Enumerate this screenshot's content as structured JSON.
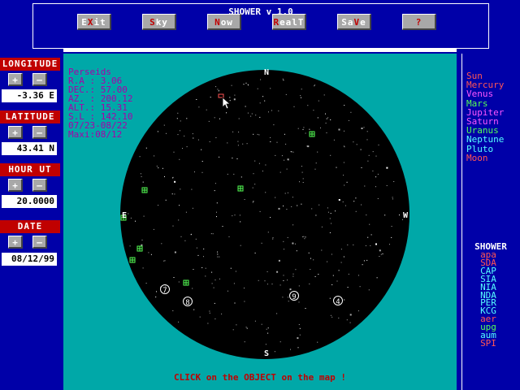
{
  "app": {
    "title": "SHOWER v 1.0"
  },
  "toolbar": {
    "buttons": [
      {
        "pre": "E",
        "hk": "X",
        "post": "it"
      },
      {
        "pre": "",
        "hk": "S",
        "post": "ky"
      },
      {
        "pre": "",
        "hk": "N",
        "post": "ow"
      },
      {
        "pre": "",
        "hk": "R",
        "post": "ealT"
      },
      {
        "pre": "Sa",
        "hk": "V",
        "post": "e"
      },
      {
        "pre": "",
        "hk": "",
        "post": "?"
      }
    ]
  },
  "controls": {
    "plus": "+",
    "minus": "–",
    "longitude": {
      "label": "LONGITUDE",
      "value": "-3.36  E"
    },
    "latitude": {
      "label": "LATITUDE",
      "value": "43.41  N"
    },
    "hour": {
      "label": "HOUR  UT",
      "value": "20.0000"
    },
    "date": {
      "label": "DATE",
      "value": "08/12/99"
    }
  },
  "info": {
    "name": "Perseids",
    "ra": "R.A : 3.06",
    "dec": "DEC.: 57.00",
    "az": "AZ. : 200.12",
    "alt": "ALT.: 15.31",
    "sl": "S.L : 142.10",
    "period": "07/23-08/22",
    "maxi": "Maxi:08/12"
  },
  "compass": {
    "n": "N",
    "s": "S",
    "e": "E",
    "w": "W"
  },
  "hint": "CLICK on the OBJECT on the map !",
  "planets": [
    {
      "name": "Sun",
      "color": "#ff5555"
    },
    {
      "name": "Mercury",
      "color": "#ff5555"
    },
    {
      "name": "Venus",
      "color": "#ff55ff"
    },
    {
      "name": "Mars",
      "color": "#55ff55"
    },
    {
      "name": "Jupiter",
      "color": "#ff55ff"
    },
    {
      "name": "Saturn",
      "color": "#ff55ff"
    },
    {
      "name": "Uranus",
      "color": "#55ff55"
    },
    {
      "name": "Neptune",
      "color": "#55ffff"
    },
    {
      "name": "Pluto",
      "color": "#55ffff"
    },
    {
      "name": "Moon",
      "color": "#ff5555"
    }
  ],
  "shower_header": "SHOWER",
  "showers": [
    {
      "code": "apa",
      "color": "#ff5555"
    },
    {
      "code": "SDA",
      "color": "#ff5555"
    },
    {
      "code": "CAP",
      "color": "#55ffff"
    },
    {
      "code": "SIA",
      "color": "#55ffff"
    },
    {
      "code": "NIA",
      "color": "#55ffff"
    },
    {
      "code": "NDA",
      "color": "#55ffff"
    },
    {
      "code": "PER",
      "color": "#55ffff"
    },
    {
      "code": "KCG",
      "color": "#55ffff"
    },
    {
      "code": "aer",
      "color": "#ff5555"
    },
    {
      "code": "upg",
      "color": "#55ff55"
    },
    {
      "code": "aum",
      "color": "#55ffff"
    },
    {
      "code": "SPI",
      "color": "#ff5555"
    }
  ],
  "markers": [
    "7",
    "8",
    "9",
    "4"
  ],
  "colors": {
    "bg": "#0000a8",
    "sky": "#00a8a8",
    "header": "#c00000",
    "button": "#a8a8a8",
    "info": "#a800a8"
  }
}
